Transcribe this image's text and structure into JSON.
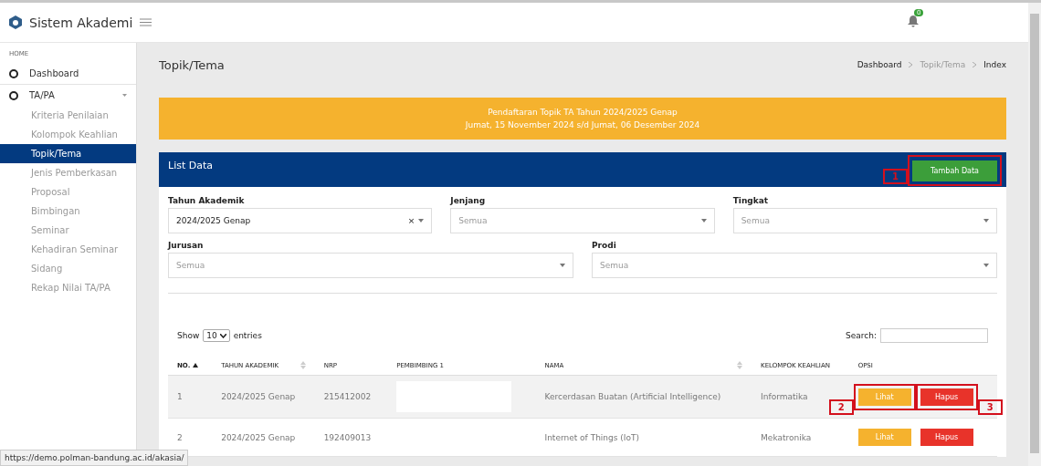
{
  "app": {
    "title": "Sistem Akademi"
  },
  "notifications": {
    "count": "0"
  },
  "sidebar": {
    "section": "HOME",
    "items": [
      {
        "label": "Dashboard",
        "kind": "top",
        "selected": false
      },
      {
        "label": "TA/PA",
        "kind": "group",
        "expanded": true,
        "selected": false,
        "children": [
          {
            "label": "Kriteria Penilaian",
            "selected": false
          },
          {
            "label": "Kolompok Keahlian",
            "selected": false
          },
          {
            "label": "Topik/Tema",
            "selected": true
          },
          {
            "label": "Jenis Pemberkasan",
            "selected": false
          },
          {
            "label": "Proposal",
            "selected": false
          },
          {
            "label": "Bimbingan",
            "selected": false
          },
          {
            "label": "Seminar",
            "selected": false
          },
          {
            "label": "Kehadiran Seminar",
            "selected": false
          },
          {
            "label": "Sidang",
            "selected": false
          },
          {
            "label": "Rekap Nilai TA/PA",
            "selected": false
          }
        ]
      }
    ]
  },
  "page": {
    "title": "Topik/Tema",
    "breadcrumb": [
      {
        "label": "Dashboard",
        "muted": false
      },
      {
        "label": "Topik/Tema",
        "muted": true
      },
      {
        "label": "Index",
        "muted": false
      }
    ]
  },
  "banner": {
    "lines": [
      "Pendaftaran Topik TA Tahun 2024/2025 Genap",
      "Jumat, 15 November 2024 s/d Jumat, 06 Desember 2024"
    ]
  },
  "card": {
    "title": "List Data",
    "add_button": {
      "label": "Tambah Data",
      "annotation": "1"
    }
  },
  "filter_rows": [
    [
      {
        "label": "Tahun Akademik",
        "value": "2024/2025 Genap",
        "clear_icon": "×"
      },
      {
        "label": "Jenjang",
        "placeholder": "Semua"
      },
      {
        "label": "Tingkat",
        "placeholder": "Semua"
      }
    ],
    [
      {
        "label": "Jurusan",
        "placeholder": "Semua"
      },
      {
        "label": "Prodi",
        "placeholder": "Semua"
      }
    ]
  ],
  "table_controls": {
    "show_label": "Show",
    "page_size": "10",
    "entries_label": "entries",
    "search_label": "Search:"
  },
  "table": {
    "columns": [
      {
        "label": "NO.",
        "sorted": true,
        "sortable": true
      },
      {
        "label": "TAHUN AKADEMIK",
        "sorted": false,
        "sortable": true
      },
      {
        "label": "NRP",
        "sorted": false,
        "sortable": false
      },
      {
        "label": "PEMBIMBING 1",
        "sorted": false,
        "sortable": false
      },
      {
        "label": "NAMA",
        "sorted": false,
        "sortable": true
      },
      {
        "label": "KELOMPOK KEAHLIAN",
        "sorted": false,
        "sortable": false
      },
      {
        "label": "OPSI",
        "sorted": false,
        "sortable": false
      }
    ],
    "rows": [
      {
        "no": "1",
        "tahun": "2024/2025 Genap",
        "nrp": "215412002",
        "pembimbing_redacted": true,
        "nama": "Kercerdasan Buatan (Artificial Intelligence)",
        "kelompok": "Informatika",
        "view": {
          "label": "Lihat",
          "annotation": "2"
        },
        "delete": {
          "label": "Hapus",
          "annotation": "3"
        }
      },
      {
        "no": "2",
        "tahun": "2024/2025 Genap",
        "nrp": "192409013",
        "pembimbing_redacted": false,
        "nama": "Internet of Things (IoT)",
        "kelompok": "Mekatronika",
        "view": {
          "label": "Lihat"
        },
        "delete": {
          "label": "Hapus"
        }
      }
    ]
  },
  "status_bar": {
    "url": "https://demo.polman-bandung.ac.id/akasia/"
  }
}
